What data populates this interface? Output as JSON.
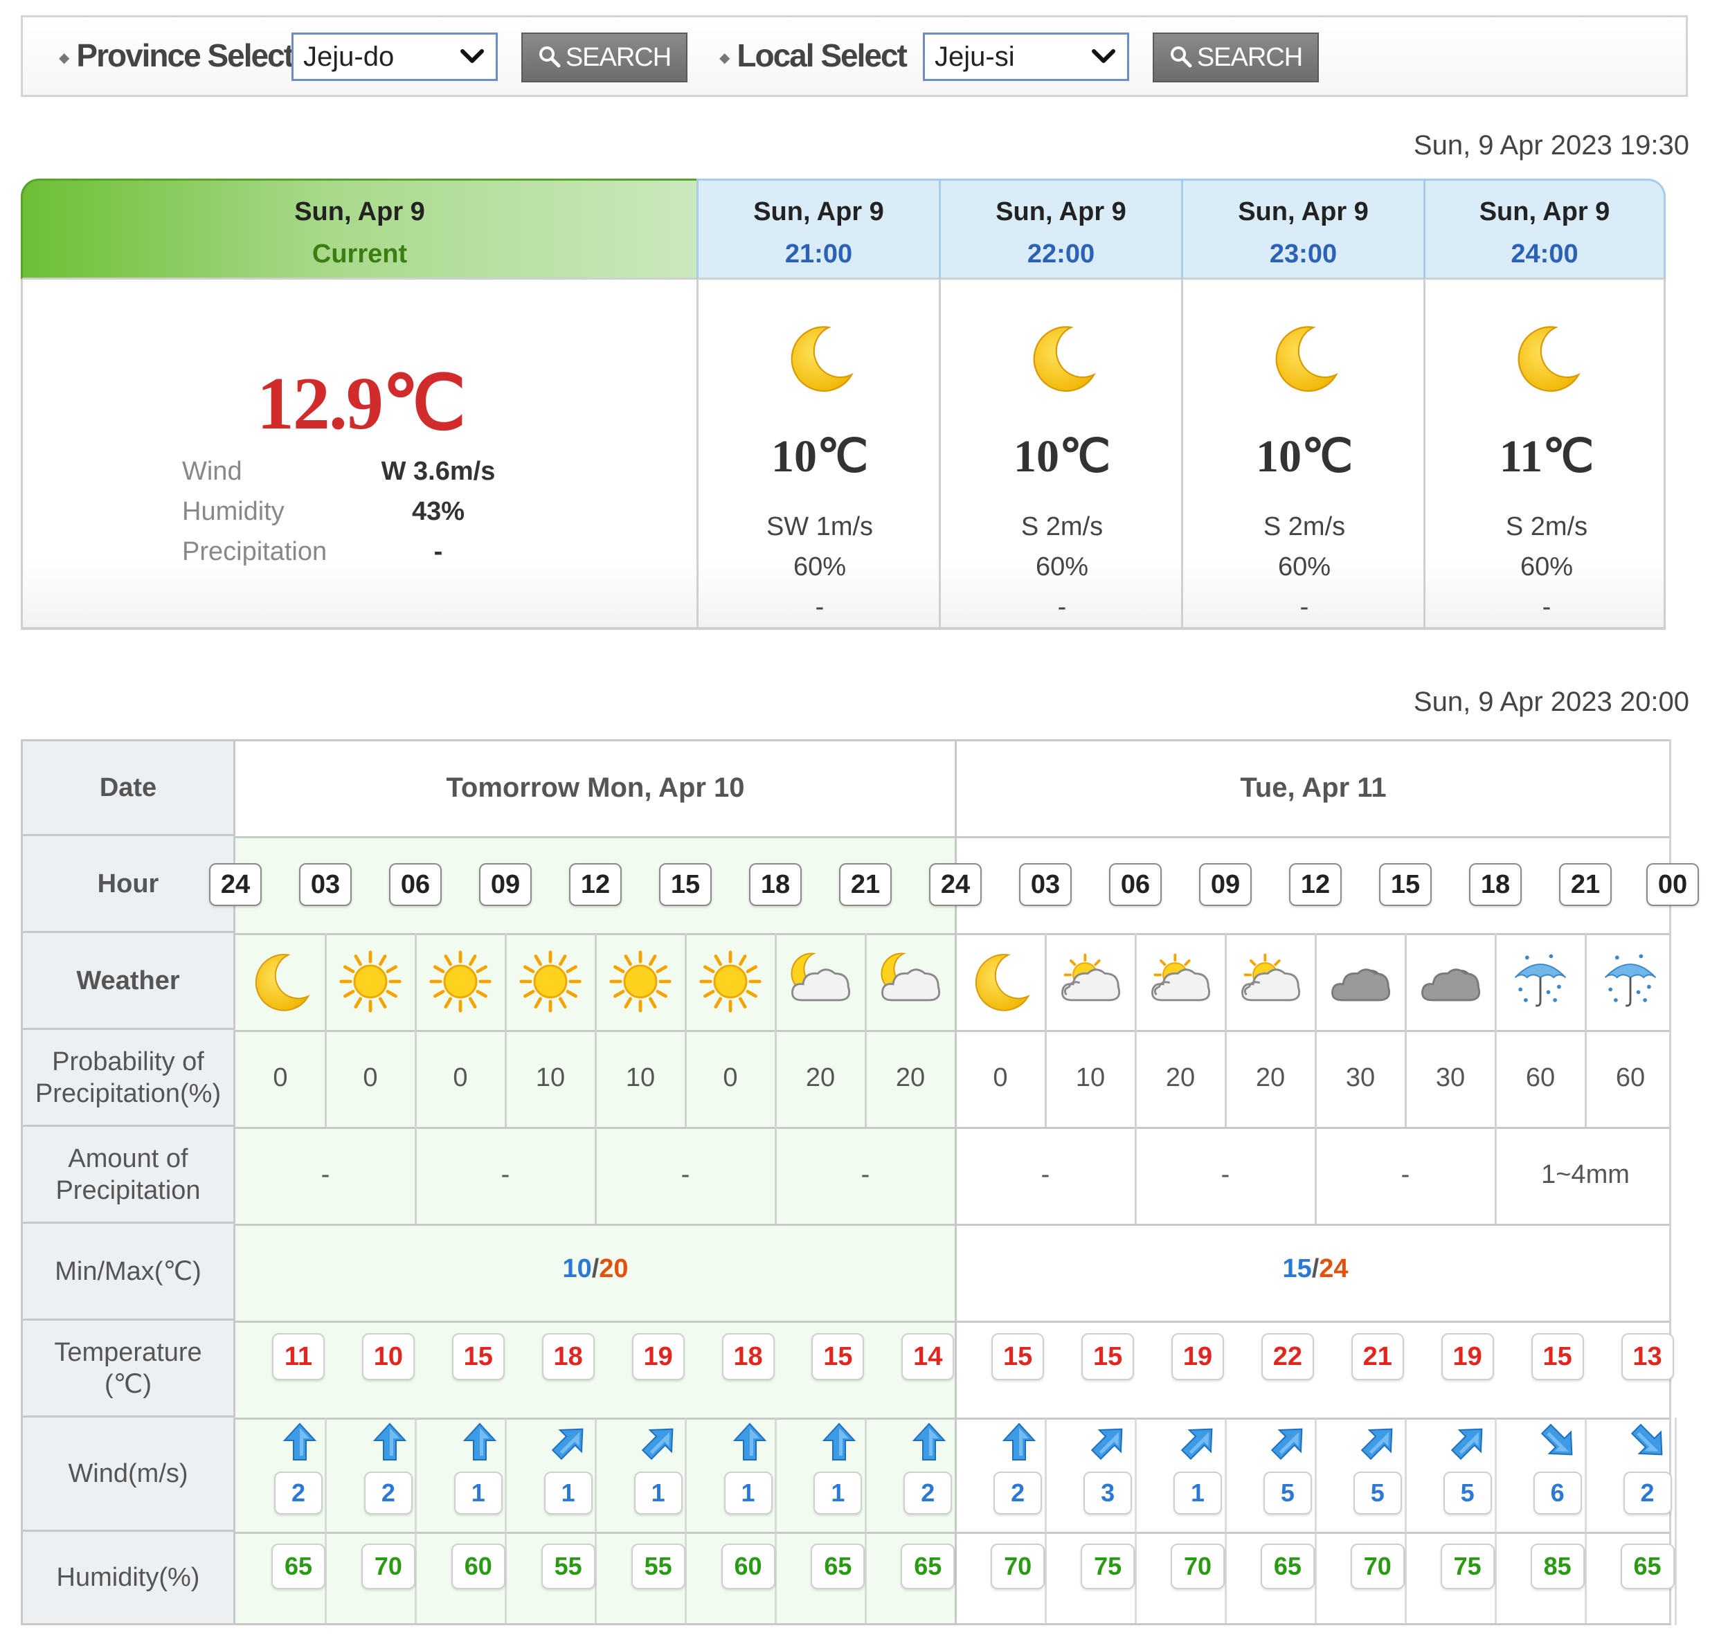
{
  "search": {
    "province_label": "Province Select",
    "province_value": "Jeju-do",
    "search_label": "SEARCH",
    "local_label": "Local Select",
    "local_value": "Jeju-si"
  },
  "current": {
    "timestamp": "Sun, 9 Apr 2023 19:30",
    "date": "Sun, Apr 9",
    "label": "Current",
    "temperature": "12.9℃",
    "wind_label": "Wind",
    "wind": "W 3.6m/s",
    "humidity_label": "Humidity",
    "humidity": "43%",
    "precip_label": "Precipitation",
    "precip": "-"
  },
  "forecast": [
    {
      "date": "Sun, Apr 9",
      "time": "21:00",
      "icon": "moon-icon",
      "temp": "10℃",
      "wind": "SW 1m/s",
      "humidity": "60%",
      "precip": "-"
    },
    {
      "date": "Sun, Apr 9",
      "time": "22:00",
      "icon": "moon-icon",
      "temp": "10℃",
      "wind": "S 2m/s",
      "humidity": "60%",
      "precip": "-"
    },
    {
      "date": "Sun, Apr 9",
      "time": "23:00",
      "icon": "moon-icon",
      "temp": "10℃",
      "wind": "S 2m/s",
      "humidity": "60%",
      "precip": "-"
    },
    {
      "date": "Sun, Apr 9",
      "time": "24:00",
      "icon": "moon-icon",
      "temp": "11℃",
      "wind": "S 2m/s",
      "humidity": "60%",
      "precip": "-"
    }
  ],
  "grid": {
    "timestamp": "Sun, 9 Apr 2023 20:00",
    "row_headers": {
      "date": "Date",
      "hour": "Hour",
      "weather": "Weather",
      "pop": "Probability of Precipitation(%)",
      "amount": "Amount of Precipitation",
      "minmax": "Min/Max(℃)",
      "temperature": "Temperature (℃)",
      "wind": "Wind(m/s)",
      "humidity": "Humidity(%)"
    },
    "days": [
      "Tomorrow Mon, Apr 10",
      "Tue, Apr 11"
    ],
    "hours": [
      "24",
      "03",
      "06",
      "09",
      "12",
      "15",
      "18",
      "21",
      "24",
      "03",
      "06",
      "09",
      "12",
      "15",
      "18",
      "21",
      "00"
    ],
    "weather": [
      "moon-icon",
      "sun-icon",
      "sun-icon",
      "sun-icon",
      "sun-icon",
      "sun-icon",
      "cloud-moon-icon",
      "cloud-moon-icon",
      "moon-icon",
      "partly-cloudy-icon",
      "partly-cloudy-icon",
      "partly-cloudy-icon",
      "cloudy-icon",
      "cloudy-icon",
      "rain-umbrella-icon",
      "rain-umbrella-icon"
    ],
    "pop": [
      "0",
      "0",
      "0",
      "10",
      "10",
      "0",
      "20",
      "20",
      "0",
      "10",
      "20",
      "20",
      "30",
      "30",
      "60",
      "60"
    ],
    "amount": [
      "-",
      "-",
      "-",
      "-",
      "-",
      "-",
      "-",
      "1~4mm"
    ],
    "minmax": [
      {
        "min": "10",
        "max": "20"
      },
      {
        "min": "15",
        "max": "24"
      }
    ],
    "temperature": [
      "11",
      "10",
      "15",
      "18",
      "19",
      "18",
      "15",
      "14",
      "15",
      "15",
      "19",
      "22",
      "21",
      "19",
      "15",
      "13"
    ],
    "wind_speed": [
      "2",
      "2",
      "1",
      "1",
      "1",
      "1",
      "1",
      "2",
      "2",
      "3",
      "1",
      "5",
      "5",
      "5",
      "6",
      "2"
    ],
    "wind_direction": [
      "up",
      "up",
      "up",
      "up-right",
      "up-right",
      "up",
      "up",
      "up",
      "up",
      "up-right",
      "up-right",
      "up-right",
      "up-right",
      "up-right",
      "down-right",
      "down-right"
    ],
    "humidity": [
      "65",
      "70",
      "60",
      "55",
      "55",
      "60",
      "65",
      "65",
      "70",
      "75",
      "70",
      "65",
      "70",
      "75",
      "85",
      "65"
    ]
  },
  "colors": {
    "accent_green": "#6cbf34",
    "temp_red": "#e0261f",
    "min_blue": "#2b78d6",
    "max_orange": "#e2520f",
    "humidity_green": "#2a9a15"
  }
}
